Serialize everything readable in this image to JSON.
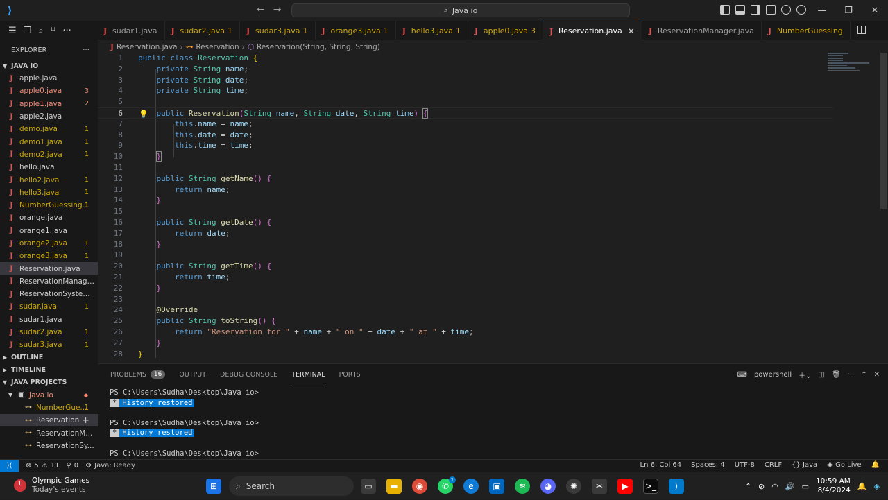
{
  "titlebar": {
    "search_label": "Java io"
  },
  "tabs": [
    {
      "label": "sudar1.java",
      "count": "",
      "state": "normal"
    },
    {
      "label": "sudar2.java",
      "count": "1",
      "state": "warn"
    },
    {
      "label": "sudar3.java",
      "count": "1",
      "state": "warn"
    },
    {
      "label": "orange3.java",
      "count": "1",
      "state": "warn"
    },
    {
      "label": "hello3.java",
      "count": "1",
      "state": "warn"
    },
    {
      "label": "apple0.java",
      "count": "3",
      "state": "warn"
    },
    {
      "label": "Reservation.java",
      "count": "",
      "state": "active"
    },
    {
      "label": "ReservationManager.java",
      "count": "",
      "state": "normal"
    },
    {
      "label": "NumberGuessing",
      "count": "",
      "state": "warn"
    }
  ],
  "sidebar": {
    "explorer_title": "EXPLORER",
    "folder": "JAVA IO",
    "files": [
      {
        "name": "apple.java",
        "count": "",
        "state": "normal"
      },
      {
        "name": "apple0.java",
        "count": "3",
        "state": "err"
      },
      {
        "name": "apple1.java",
        "count": "2",
        "state": "err"
      },
      {
        "name": "apple2.java",
        "count": "",
        "state": "normal"
      },
      {
        "name": "demo.java",
        "count": "1",
        "state": "warn"
      },
      {
        "name": "demo1.java",
        "count": "1",
        "state": "warn"
      },
      {
        "name": "demo2.java",
        "count": "1",
        "state": "warn"
      },
      {
        "name": "hello.java",
        "count": "",
        "state": "normal"
      },
      {
        "name": "hello2.java",
        "count": "1",
        "state": "warn"
      },
      {
        "name": "hello3.java",
        "count": "1",
        "state": "warn"
      },
      {
        "name": "NumberGuessing...",
        "count": "1",
        "state": "warn"
      },
      {
        "name": "orange.java",
        "count": "",
        "state": "normal"
      },
      {
        "name": "orange1.java",
        "count": "",
        "state": "normal"
      },
      {
        "name": "orange2.java",
        "count": "1",
        "state": "warn"
      },
      {
        "name": "orange3.java",
        "count": "1",
        "state": "warn"
      },
      {
        "name": "Reservation.java",
        "count": "",
        "state": "selected"
      },
      {
        "name": "ReservationManager.j...",
        "count": "",
        "state": "normal"
      },
      {
        "name": "ReservationSystem.java",
        "count": "",
        "state": "normal"
      },
      {
        "name": "sudar.java",
        "count": "1",
        "state": "warn"
      },
      {
        "name": "sudar1.java",
        "count": "",
        "state": "normal"
      },
      {
        "name": "sudar2.java",
        "count": "1",
        "state": "warn"
      },
      {
        "name": "sudar3.java",
        "count": "1",
        "state": "warn"
      }
    ],
    "outline": "OUTLINE",
    "timeline": "TIMELINE",
    "java_projects": "JAVA PROJECTS",
    "project_name": "Java io",
    "project_items": [
      {
        "name": "NumberGue...",
        "count": "1"
      },
      {
        "name": "Reservation",
        "count": ""
      },
      {
        "name": "ReservationM...",
        "count": ""
      },
      {
        "name": "ReservationSy...",
        "count": ""
      }
    ]
  },
  "breadcrumb": {
    "file": "Reservation.java",
    "class": "Reservation",
    "method": "Reservation(String, String, String)"
  },
  "editor": {
    "line_numbers": [
      "1",
      "2",
      "3",
      "4",
      "5",
      "6",
      "7",
      "8",
      "9",
      "10",
      "11",
      "12",
      "13",
      "14",
      "15",
      "16",
      "17",
      "18",
      "19",
      "20",
      "21",
      "22",
      "23",
      "24",
      "25",
      "26",
      "27",
      "28"
    ]
  },
  "panel": {
    "tabs": [
      "PROBLEMS",
      "OUTPUT",
      "DEBUG CONSOLE",
      "TERMINAL",
      "PORTS"
    ],
    "problems_count": "16",
    "shell": "powershell",
    "prompt": "PS C:\\Users\\Sudha\\Desktop\\Java io>",
    "history": "History restored",
    "history_star": "*"
  },
  "statusbar": {
    "errors": "5",
    "warnings": "11",
    "ports": "0",
    "java_status": "Java: Ready",
    "position": "Ln 6, Col 64",
    "spaces": "Spaces: 4",
    "encoding": "UTF-8",
    "eol": "CRLF",
    "language": "Java",
    "golive": "Go Live"
  },
  "taskbar": {
    "weather_title": "Olympic Games",
    "weather_sub": "Today's events",
    "weather_badge": "1",
    "search": "Search",
    "whatsapp_badge": "1",
    "time": "10:59 AM",
    "date": "8/4/2024"
  }
}
